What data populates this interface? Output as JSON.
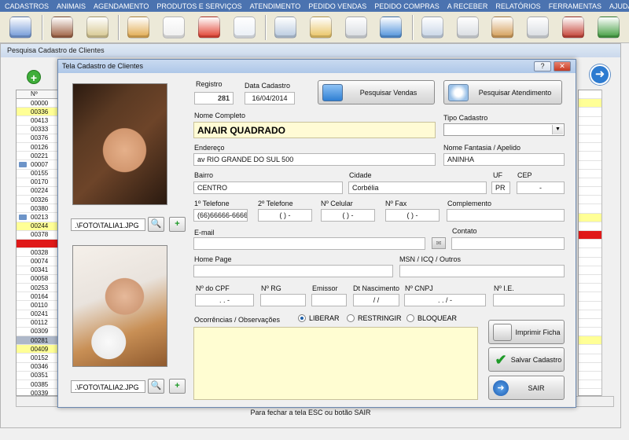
{
  "menu": [
    "CADASTROS",
    "ANIMAIS",
    "AGENDAMENTO",
    "PRODUTOS E SERVIÇOS",
    "ATENDIMENTO",
    "PEDIDO VENDAS",
    "PEDIDO COMPRAS",
    "A RECEBER",
    "RELATÓRIOS",
    "FERRAMENTAS",
    "AJUDA"
  ],
  "toolbar_icons": [
    "users-icon",
    "user-icon",
    "wrench-clipboard-icon",
    "boxes-icon",
    "barcode-icon",
    "paw-icon",
    "pet-plus-icon",
    "search-list-icon",
    "folder-icon",
    "printer-icon",
    "monitor-icon",
    "search-doc-icon",
    "printer-icon",
    "money-calculator-icon",
    "printer-icon",
    "help-person-icon",
    "exit-icon"
  ],
  "back_window": {
    "title": "Pesquisa Cadastro de Clientes",
    "grid_header": "Nº",
    "rows": [
      {
        "code": "00000",
        "style": ""
      },
      {
        "code": "00336",
        "style": "y"
      },
      {
        "code": "00413",
        "style": ""
      },
      {
        "code": "00333",
        "style": ""
      },
      {
        "code": "00376",
        "style": ""
      },
      {
        "code": "00126",
        "style": ""
      },
      {
        "code": "00221",
        "style": ""
      },
      {
        "code": "00007",
        "style": "mark"
      },
      {
        "code": "00155",
        "style": ""
      },
      {
        "code": "00170",
        "style": ""
      },
      {
        "code": "00224",
        "style": ""
      },
      {
        "code": "00326",
        "style": ""
      },
      {
        "code": "00380",
        "style": ""
      },
      {
        "code": "00213",
        "style": "mark"
      },
      {
        "code": "00244",
        "style": "y"
      },
      {
        "code": "00378",
        "style": ""
      },
      {
        "code": "",
        "style": "r"
      },
      {
        "code": "00328",
        "style": ""
      },
      {
        "code": "00074",
        "style": ""
      },
      {
        "code": "00341",
        "style": ""
      },
      {
        "code": "00058",
        "style": ""
      },
      {
        "code": "00253",
        "style": ""
      },
      {
        "code": "00164",
        "style": ""
      },
      {
        "code": "00110",
        "style": ""
      },
      {
        "code": "00241",
        "style": ""
      },
      {
        "code": "00112",
        "style": ""
      },
      {
        "code": "00309",
        "style": ""
      },
      {
        "code": "00281",
        "style": "gsel"
      },
      {
        "code": "00409",
        "style": "y"
      },
      {
        "code": "00152",
        "style": ""
      },
      {
        "code": "00346",
        "style": ""
      },
      {
        "code": "00351",
        "style": ""
      },
      {
        "code": "00385",
        "style": ""
      },
      {
        "code": "00339",
        "style": ""
      }
    ],
    "status_text": "Para fechar a tela ESC ou botão SAIR"
  },
  "modal": {
    "title": "Tela Cadastro de Clientes",
    "help": "?",
    "close": "✕",
    "photo1_path": ".\\FOTO\\TALIA1.JPG",
    "photo2_path": ".\\FOTO\\TALIA2.JPG",
    "registro_label": "Registro",
    "registro": "281",
    "data_cadastro_label": "Data Cadastro",
    "data_cadastro": "16/04/2014",
    "pesquisar_vendas": "Pesquisar Vendas",
    "pesquisar_atendimento": "Pesquisar Atendimento",
    "nome_label": "Nome Completo",
    "nome": "ANAIR QUADRADO",
    "tipo_label": "Tipo Cadastro",
    "tipo": "",
    "endereco_label": "Endereço",
    "endereco": "av RIO GRANDE DO SUL    500",
    "fantasia_label": "Nome Fantasia / Apelido",
    "fantasia": "ANINHA",
    "bairro_label": "Bairro",
    "bairro": "CENTRO",
    "cidade_label": "Cidade",
    "cidade": "Corbélia",
    "uf_label": "UF",
    "uf": "PR",
    "cep_label": "CEP",
    "cep": "-",
    "tel1_label": "1º Telefone",
    "tel1": "(66)66666-6666",
    "tel2_label": "2º Telefone",
    "tel2": "(   )      -",
    "cel_label": "Nº Celular",
    "cel": "(   )      -",
    "fax_label": "Nº Fax",
    "fax": "(   )      -",
    "complemento_label": "Complemento",
    "complemento": "",
    "email_label": "E-mail",
    "email": "",
    "contato_label": "Contato",
    "contato": "",
    "homepage_label": "Home Page",
    "homepage": "",
    "msn_label": "MSN / ICQ / Outros",
    "msn": "",
    "cpf_label": "Nº do CPF",
    "cpf": ".   .    -",
    "rg_label": "Nº RG",
    "rg": "",
    "emissor_label": "Emissor",
    "emissor": "",
    "nasc_label": "Dt Nascimento",
    "nasc": "/   /",
    "cnpj_label": "Nº CNPJ",
    "cnpj": ".   .   /    -",
    "ie_label": "Nº I.E.",
    "ie": "",
    "obs_label": "Ocorrências / Observações",
    "radio_liberar": "LIBERAR",
    "radio_restringir": "RESTRINGIR",
    "radio_bloquear": "BLOQUEAR",
    "imprimir": "Imprimir Ficha",
    "salvar": "Salvar Cadastro",
    "sair": "SAIR"
  }
}
